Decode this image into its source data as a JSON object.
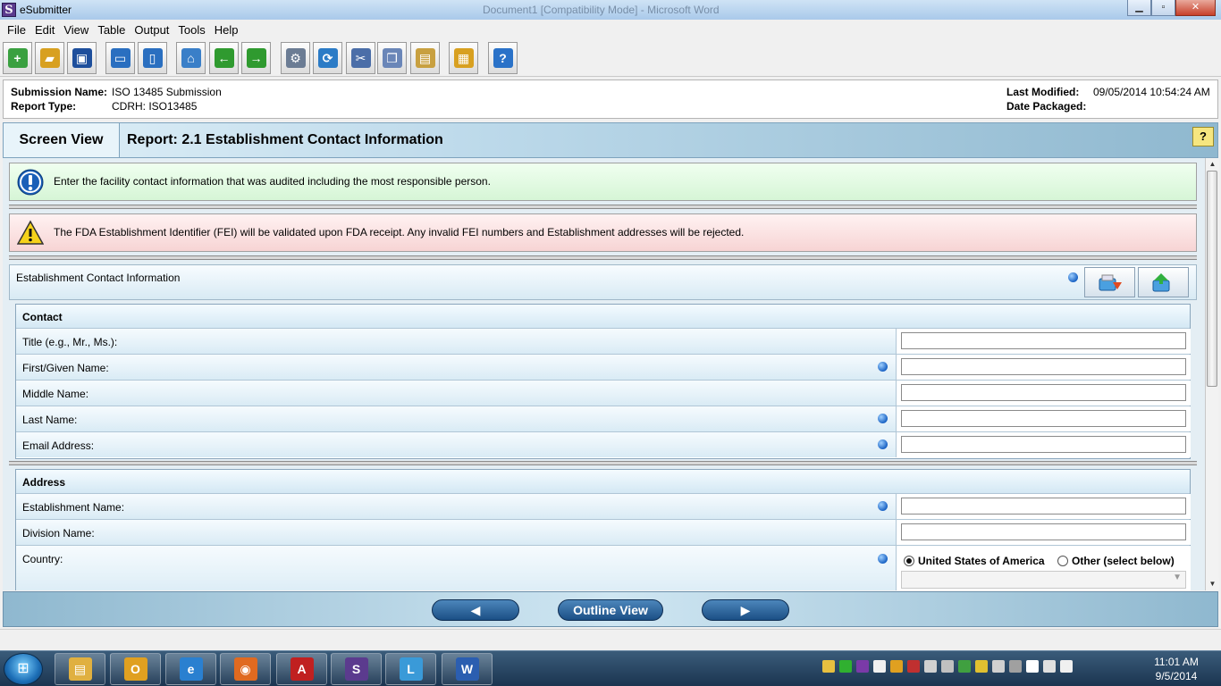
{
  "window": {
    "title": "eSubmitter",
    "background_title": "Document1 [Compatibility Mode] - Microsoft Word",
    "minimize_glyph": "▁",
    "maximize_glyph": "▫",
    "close_glyph": "✕",
    "app_icon_glyph": "S"
  },
  "menu": [
    "File",
    "Edit",
    "View",
    "Table",
    "Output",
    "Tools",
    "Help"
  ],
  "toolbar": {
    "buttons": [
      {
        "icon": "new-document-icon",
        "glyph": "+",
        "color": "#3aa040"
      },
      {
        "icon": "open-folder-icon",
        "glyph": "▰",
        "color": "#d8a020"
      },
      {
        "icon": "save-icon",
        "glyph": "▣",
        "color": "#1e4f9c"
      },
      {
        "icon": "window-icon",
        "glyph": "▭",
        "color": "#2a6fc0"
      },
      {
        "icon": "split-view-icon",
        "glyph": "▯",
        "color": "#2a6fc0"
      },
      {
        "icon": "home-icon",
        "glyph": "⌂",
        "color": "#3a7fc8"
      },
      {
        "icon": "back-arrow-icon",
        "glyph": "←",
        "color": "#2f9a2f"
      },
      {
        "icon": "forward-arrow-icon",
        "glyph": "→",
        "color": "#2f9a2f"
      },
      {
        "icon": "settings-gears-icon",
        "glyph": "⚙",
        "color": "#6b7c94"
      },
      {
        "icon": "refresh-icon",
        "glyph": "⟳",
        "color": "#2b7bc6"
      },
      {
        "icon": "cut-scissors-icon",
        "glyph": "✂",
        "color": "#4b6ea8"
      },
      {
        "icon": "copy-icon",
        "glyph": "❐",
        "color": "#6a86b8"
      },
      {
        "icon": "paste-icon",
        "glyph": "▤",
        "color": "#c8a040"
      },
      {
        "icon": "package-box-icon",
        "glyph": "▦",
        "color": "#d8a020"
      },
      {
        "icon": "help-icon",
        "glyph": "?",
        "color": "#2a72c8"
      }
    ]
  },
  "header": {
    "submission_name_label": "Submission Name:",
    "submission_name": "ISO 13485 Submission",
    "report_type_label": "Report Type:",
    "report_type": "CDRH: ISO13485",
    "last_modified_label": "Last Modified:",
    "last_modified": "09/05/2014 10:54:24 AM",
    "date_packaged_label": "Date Packaged:"
  },
  "viewbar": {
    "screen_view": "Screen View",
    "report_title": "Report: 2.1 Establishment Contact Information",
    "help_glyph": "?"
  },
  "messages": {
    "info": "Enter the facility contact information that was audited including the most responsible person.",
    "warning": "The FDA Establishment Identifier (FEI) will be validated upon FDA receipt.  Any invalid FEI numbers and Establishment addresses will be rejected."
  },
  "section": {
    "title": "Establishment Contact Information"
  },
  "contact": {
    "header": "Contact",
    "fields": [
      {
        "label": "Title (e.g., Mr., Ms.):",
        "value": "",
        "required": false
      },
      {
        "label": "First/Given Name:",
        "value": "",
        "required": true
      },
      {
        "label": "Middle Name:",
        "value": "",
        "required": false
      },
      {
        "label": "Last Name:",
        "value": "",
        "required": true
      },
      {
        "label": "Email Address:",
        "value": "",
        "required": true
      }
    ]
  },
  "address": {
    "header": "Address",
    "fields": [
      {
        "label": "Establishment Name:",
        "value": "",
        "required": true
      },
      {
        "label": "Division Name:",
        "value": "",
        "required": false
      }
    ],
    "country_label": "Country:",
    "country_options": [
      "United States of America",
      "Other (select below)"
    ],
    "country_selected": "United States of America"
  },
  "footer": {
    "prev_glyph": "◀",
    "outline_view": "Outline View",
    "next_glyph": "▶"
  },
  "taskbar": {
    "start_glyph": "⊞",
    "apps": [
      {
        "icon": "file-explorer-icon",
        "glyph": "▤",
        "color": "#e0b040"
      },
      {
        "icon": "outlook-icon",
        "glyph": "O",
        "color": "#e0a020"
      },
      {
        "icon": "internet-explorer-icon",
        "glyph": "e",
        "color": "#2a80d0"
      },
      {
        "icon": "firefox-icon",
        "glyph": "◉",
        "color": "#e06a20"
      },
      {
        "icon": "acrobat-icon",
        "glyph": "A",
        "color": "#c02020"
      },
      {
        "icon": "esubmitter-icon",
        "glyph": "S",
        "color": "#5b3b8e"
      },
      {
        "icon": "network-app-icon",
        "glyph": "L",
        "color": "#3a9ad8"
      },
      {
        "icon": "word-icon",
        "glyph": "W",
        "color": "#2b5eb0"
      }
    ],
    "tray_colors": [
      "#e8c040",
      "#30b030",
      "#7a3aa8",
      "#f0f0f0",
      "#e0a020",
      "#c03030",
      "#d0d0d0",
      "#c0c0c0",
      "#40a040",
      "#e0c030",
      "#d0d0d0",
      "#a0a0a0",
      "#ffffff",
      "#e0e0e0",
      "#f0f0f0"
    ],
    "time": "11:01 AM",
    "date": "9/5/2014"
  }
}
